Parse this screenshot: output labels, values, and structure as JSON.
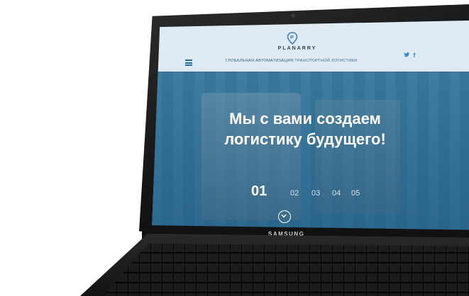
{
  "device": {
    "brand_label": "SAMSUNG"
  },
  "site": {
    "brand": "PLANARRY",
    "tagline_part1": "ГЛОБАЛЬНАЯ АВТОМАТИЗАЦИЯ",
    "tagline_part2": "ТРАНСПОРТНОЙ ЛОГИСТИКИ",
    "social_twitter_icon": "twitter-icon",
    "social_facebook_icon": "facebook-icon",
    "twitter_glyph": "🐦",
    "facebook_glyph": "f",
    "menu_icon": "hamburger-menu-icon"
  },
  "hero": {
    "headline_line1": "Мы с вами создаем",
    "headline_line2": "логистику будущего!",
    "slides": [
      "01",
      "02",
      "03",
      "04",
      "05"
    ],
    "active_slide": "01",
    "scroll_icon": "chevron-down-icon"
  },
  "colors": {
    "header_bg": "#dfeaf2",
    "accent": "#1f6fb0",
    "hero_overlay": "#2f6f92"
  }
}
